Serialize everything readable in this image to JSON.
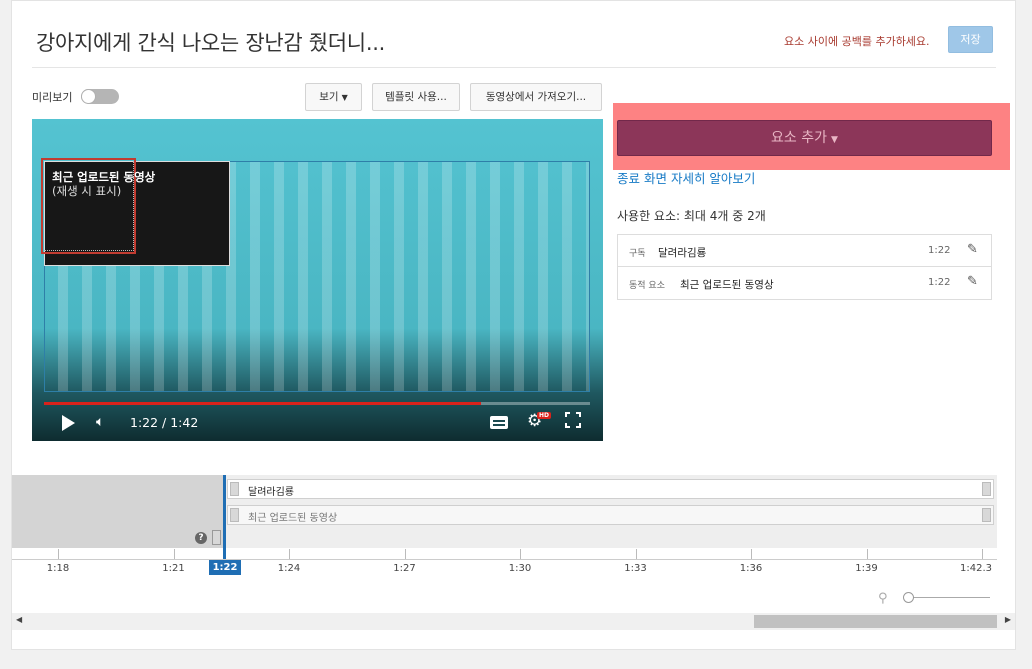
{
  "header": {
    "title": "강아지에게 간식 나오는 장난감 줬더니...",
    "hint": "요소 사이에 공백를 추가하세요.",
    "save_label": "저장"
  },
  "toolbar": {
    "preview_label": "미리보기",
    "preview_toggle_on": false,
    "view_label": "보기",
    "template_label": "템플릿 사용...",
    "import_label": "동영상에서 가져오기..."
  },
  "player": {
    "card_title": "최근 업로드된 동영상",
    "card_subtitle": "(재생 시 표시)",
    "timecode": "1:22 / 1:42",
    "progress": 0.8,
    "hd_badge": "HD"
  },
  "panel": {
    "add_element_label": "요소 추가",
    "learn_more": "종료 화면 자세히 알아보기",
    "used_count": "사용한 요소: 최대 4개 중 2개",
    "elements": [
      {
        "type": "구독",
        "name": "달려라김룡",
        "time": "1:22"
      },
      {
        "type": "동적 요소",
        "name": "최근 업로드된 동영상",
        "time": "1:22"
      }
    ]
  },
  "timeline": {
    "tracks": [
      {
        "label": "달려라김룡"
      },
      {
        "label": "최근 업로드된 동영상"
      }
    ],
    "help_icon": "?",
    "playhead_label": "1:22",
    "ticks": [
      "1:18",
      "1:21",
      "1:24",
      "1:27",
      "1:30",
      "1:33",
      "1:36",
      "1:39",
      "1:42.3"
    ]
  },
  "colors": {
    "accent_blue": "#167ac6",
    "add_button": "#8c3659",
    "highlight": "#fd8283",
    "progress_red": "#d9231c"
  }
}
